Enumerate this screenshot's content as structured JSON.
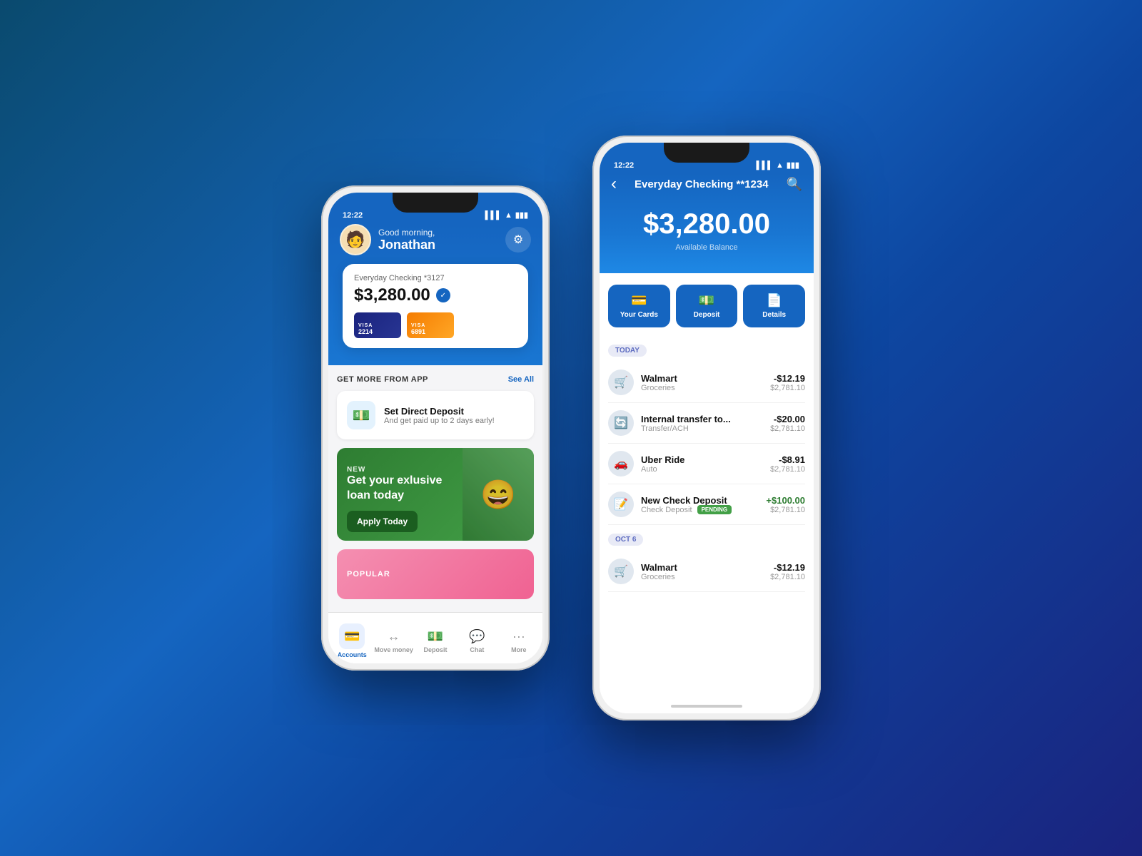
{
  "background": {
    "gradient": "linear-gradient(135deg, #0a4a6e 0%, #1565c0 40%, #0d47a1 60%, #1a237e 100%)"
  },
  "phone1": {
    "status_bar": {
      "time": "12:22",
      "battery": "100%"
    },
    "header": {
      "greeting": "Good morning,",
      "name": "Jonathan",
      "settings_icon": "⚙"
    },
    "account_card": {
      "label": "Everyday Checking  *3127",
      "balance": "$3,280.00",
      "cards": [
        {
          "type": "VISA",
          "last4": "2214",
          "style": "dark"
        },
        {
          "type": "VISA",
          "last4": "6891",
          "style": "orange"
        }
      ]
    },
    "section": {
      "title": "GET MORE FROM APP",
      "see_all": "See All"
    },
    "promo": {
      "title": "Set Direct Deposit",
      "subtitle": "And get paid up to 2 days early!"
    },
    "loan_banner": {
      "tag": "NEW",
      "title": "Get your exlusive loan today",
      "button": "Apply Today"
    },
    "popular_section": {
      "label": "POPULAR"
    },
    "nav": {
      "items": [
        {
          "label": "Accounts",
          "icon": "💳",
          "active": true
        },
        {
          "label": "Move money",
          "icon": "↔️",
          "active": false
        },
        {
          "label": "Deposit",
          "icon": "💵",
          "active": false
        },
        {
          "label": "Chat",
          "icon": "💬",
          "active": false
        },
        {
          "label": "More",
          "icon": "···",
          "active": false
        }
      ]
    }
  },
  "phone2": {
    "status_bar": {
      "time": "12:22"
    },
    "header": {
      "title": "Everyday Checking **1234",
      "back_icon": "‹",
      "search_icon": "⌕"
    },
    "balance": {
      "amount": "$3,280.00",
      "label": "Available Balance"
    },
    "actions": [
      {
        "label": "Your Cards",
        "icon": "💳"
      },
      {
        "label": "Deposit",
        "icon": "💵"
      },
      {
        "label": "Details",
        "icon": "📄"
      }
    ],
    "transactions": {
      "sections": [
        {
          "date": "TODAY",
          "items": [
            {
              "name": "Walmart",
              "category": "Groceries",
              "amount": "-$12.19",
              "balance": "$2,781.10",
              "type": "neg",
              "icon": "🛒"
            },
            {
              "name": "Internal transfer to...",
              "category": "Transfer/ACH",
              "amount": "-$20.00",
              "balance": "$2,781.10",
              "type": "neg",
              "icon": "🔄"
            },
            {
              "name": "Uber Ride",
              "category": "Auto",
              "amount": "-$8.91",
              "balance": "$2,781.10",
              "type": "neg",
              "icon": "🚗"
            },
            {
              "name": "New Check Deposit",
              "category": "Check Deposit",
              "amount": "+$100.00",
              "balance": "$2,781.10",
              "type": "pos",
              "pending": true,
              "icon": "📝"
            }
          ]
        },
        {
          "date": "OCT 6",
          "items": [
            {
              "name": "Walmart",
              "category": "Groceries",
              "amount": "-$12.19",
              "balance": "$2,781.10",
              "type": "neg",
              "icon": "🛒"
            }
          ]
        }
      ]
    }
  }
}
